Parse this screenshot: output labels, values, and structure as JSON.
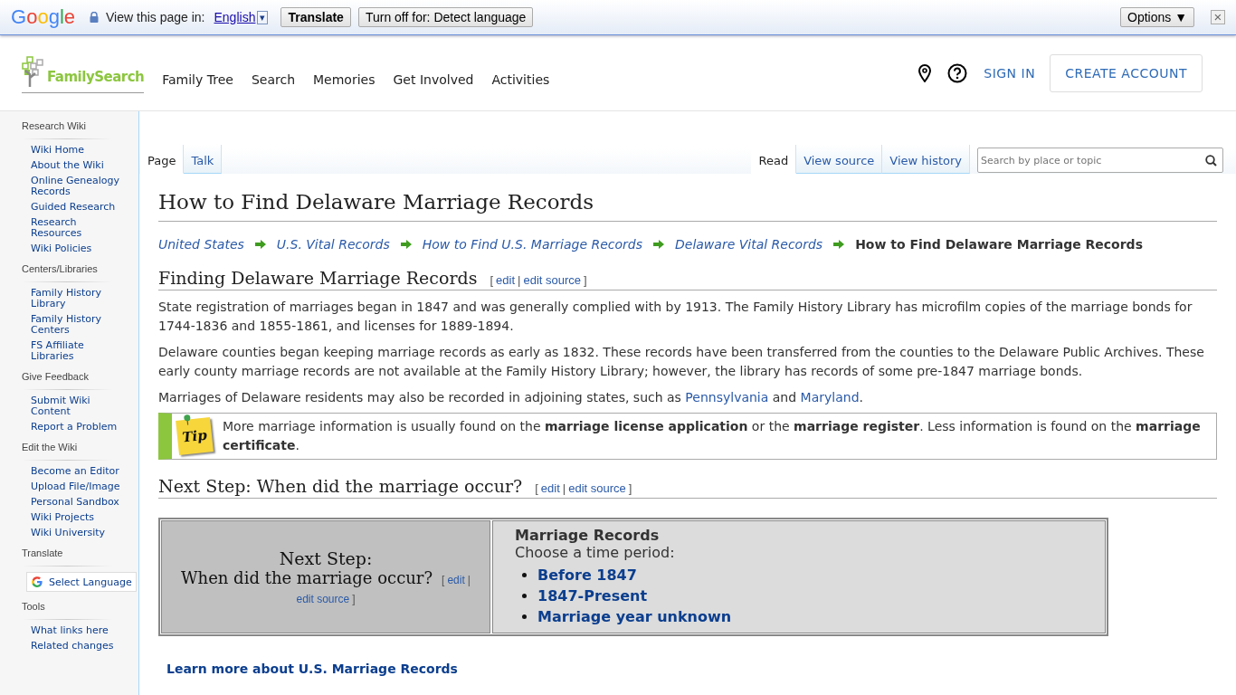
{
  "translate_bar": {
    "logo": "Google",
    "label": "View this page in:",
    "language": "English",
    "dropdown": "▾",
    "translate_button": "Translate",
    "turn_off_button": "Turn off for: Detect language",
    "options_button": "Options ▼",
    "close": "×"
  },
  "header": {
    "logo": "FamilySearch",
    "nav": [
      "Family Tree",
      "Search",
      "Memories",
      "Get Involved",
      "Activities"
    ],
    "sign_in": "SIGN IN",
    "create_account": "CREATE ACCOUNT"
  },
  "sidebar": [
    {
      "title": "Research Wiki",
      "items": [
        "Wiki Home",
        "About the Wiki",
        "Online Genealogy Records",
        "Guided Research",
        "Research Resources",
        "Wiki Policies"
      ]
    },
    {
      "title": "Centers/Libraries",
      "items": [
        "Family History Library",
        "Family History Centers",
        "FS Affiliate Libraries"
      ]
    },
    {
      "title": "Give Feedback",
      "items": [
        "Submit Wiki Content",
        "Report a Problem"
      ]
    },
    {
      "title": "Edit the Wiki",
      "items": [
        "Become an Editor",
        "Upload File/Image",
        "Personal Sandbox",
        "Wiki Projects",
        "Wiki University"
      ]
    },
    {
      "title": "Translate",
      "widget": "Select Language"
    },
    {
      "title": "Tools",
      "items": [
        "What links here",
        "Related changes"
      ]
    }
  ],
  "tabs_left": [
    {
      "label": "Page",
      "selected": true
    },
    {
      "label": "Talk",
      "selected": false
    }
  ],
  "tabs_right": [
    {
      "label": "Read",
      "selected": true
    },
    {
      "label": "View source",
      "selected": false
    },
    {
      "label": "View history",
      "selected": false
    }
  ],
  "search": {
    "placeholder": "Search by place or topic"
  },
  "title": "How to Find Delaware Marriage Records",
  "breadcrumbs": [
    {
      "label": "United States",
      "current": false
    },
    {
      "label": "U.S. Vital Records",
      "current": false
    },
    {
      "label": "How to Find U.S. Marriage Records",
      "current": false
    },
    {
      "label": "Delaware Vital Records",
      "current": false
    },
    {
      "label": "How to Find Delaware Marriage Records",
      "current": true
    }
  ],
  "section1": {
    "heading": "Finding Delaware Marriage Records",
    "edit_links": {
      "open": "[",
      "links": [
        "edit",
        "edit source"
      ],
      "separator": "|",
      "close": "]"
    },
    "paragraphs": [
      [
        {
          "text": "State registration of marriages began in 1847 and was generally complied with by 1913. The Family History Library has microfilm copies of the marriage bonds for 1744-1836 and 1855-1861, and licenses for 1889-1894.",
          "link": false
        }
      ],
      [
        {
          "text": "Delaware counties began keeping marriage records as early as 1832. These records have been transferred from the counties to the Delaware Public Archives. These early county marriage records are not available at the Family History Library; however, the library has records of some pre-1847 marriage bonds.",
          "link": false
        }
      ],
      [
        {
          "text": "Marriages of Delaware residents may also be recorded in adjoining states, such as ",
          "link": false
        },
        {
          "text": "Pennsylvania",
          "link": true
        },
        {
          "text": " and ",
          "link": false
        },
        {
          "text": "Maryland",
          "link": true
        },
        {
          "text": ".",
          "link": false
        }
      ]
    ],
    "tip": {
      "badge": "Tip",
      "text": "More marriage information is usually found on the **marriage license application** or the **marriage register**. Less information is found on the **marriage certificate**."
    }
  },
  "section2": {
    "heading": "Next Step: When did the marriage occur?",
    "edit_links": {
      "open": "[",
      "links": [
        "edit",
        "edit source"
      ],
      "separator": "|",
      "close": "]"
    }
  },
  "step_table": {
    "line1": "Next Step:",
    "line2": "When did the marriage occur?",
    "edit_links": {
      "open": "[",
      "links": [
        "edit",
        "edit source"
      ],
      "separator": "|",
      "close": "]"
    },
    "records_title": "Marriage Records",
    "prompt": "Choose a time period:",
    "options": [
      "Before 1847",
      "1847-Present",
      "Marriage year unknown"
    ]
  },
  "learn_more": "Learn more about U.S. Marriage Records"
}
